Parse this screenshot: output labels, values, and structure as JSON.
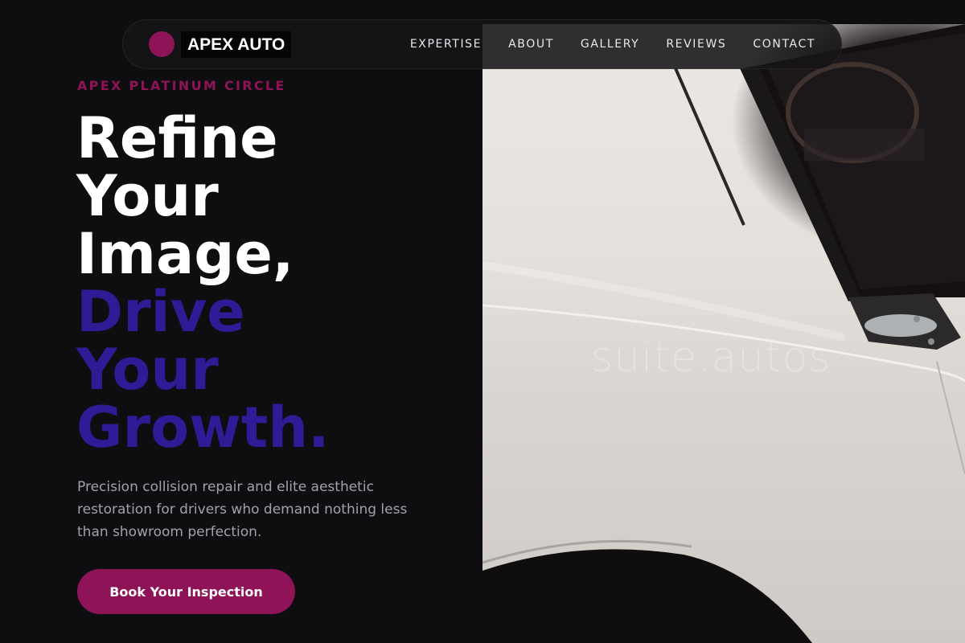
{
  "brand": {
    "name": "APEX AUTO"
  },
  "nav": {
    "items": [
      {
        "label": "EXPERTISE"
      },
      {
        "label": "ABOUT"
      },
      {
        "label": "GALLERY"
      },
      {
        "label": "REVIEWS"
      },
      {
        "label": "CONTACT"
      }
    ]
  },
  "hero": {
    "eyebrow": "APEX PLATINUM CIRCLE",
    "headline_white": [
      "Refine",
      "Your",
      "Image,"
    ],
    "headline_accent": [
      "Drive",
      "Your",
      "Growth."
    ],
    "subtitle": "Precision collision repair and elite aesthetic restoration for drivers who demand nothing less than showroom perfection.",
    "cta_label": "Book Your Inspection",
    "image_watermark": "suite.autos"
  },
  "colors": {
    "background": "#0e0d10",
    "accent_magenta": "#8e1357",
    "accent_purple": "#2e1c96",
    "text_white": "#ffffff",
    "text_muted": "#a4a1a9"
  },
  "icons": {
    "brand_mark": "circle-logo-icon"
  }
}
